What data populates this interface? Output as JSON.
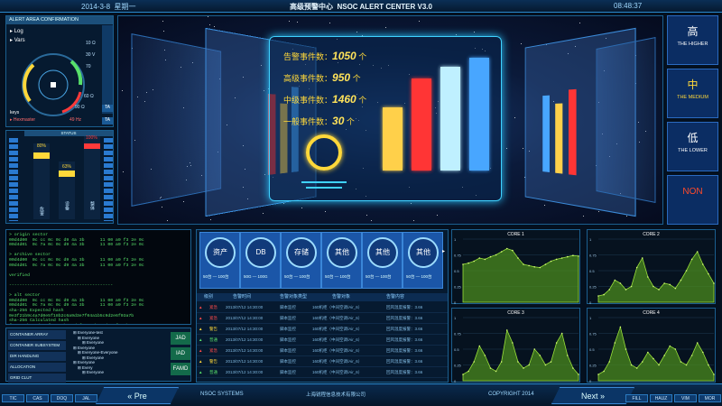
{
  "header": {
    "date": "2014-3-8",
    "weekday": "星期一",
    "title": "高级预警中心",
    "title_en": "NSOC ALERT CENTER V3.0",
    "time": "08:48:37"
  },
  "alert_panel": {
    "heading": "ALERT AREA CONFIRMATION",
    "log": "Log",
    "vars": "Vars",
    "keys": "keys",
    "param": "Hexmaster",
    "values": [
      "10 Ω",
      "30 V",
      "70",
      "60 Ω",
      "90 Ω",
      "49 Hz"
    ],
    "side_buttons": [
      "TA",
      "TA"
    ]
  },
  "status_panel": {
    "heading": "STATUS",
    "pct": [
      "80%",
      "63%",
      "100%"
    ],
    "labels": [
      "危害",
      "设备",
      "整体"
    ]
  },
  "center": {
    "stats": [
      {
        "label": "告警事件数：",
        "value": "1050",
        "unit": "个"
      },
      {
        "label": "高级事件数：",
        "value": "950",
        "unit": "个"
      },
      {
        "label": "中级事件数：",
        "value": "1460",
        "unit": "个"
      },
      {
        "label": "一般事件数：",
        "value": "30",
        "unit": "个"
      }
    ],
    "bars": [
      {
        "value": 0.55,
        "color": "#ffd04a"
      },
      {
        "value": 0.8,
        "color": "#ff3535"
      },
      {
        "value": 0.9,
        "color": "#bff0ff"
      },
      {
        "value": 0.98,
        "color": "#48a6ff"
      }
    ]
  },
  "levels": [
    {
      "cn": "高",
      "en": "THE HIGHER",
      "color": "#ffffff"
    },
    {
      "cn": "中",
      "en": "THE MEDIUM",
      "color": "#ffd83a"
    },
    {
      "cn": "低",
      "en": "THE LOWER",
      "color": "#ffffff"
    },
    {
      "cn": "NON",
      "en": "",
      "color": "#ff4a2a"
    }
  ],
  "console": {
    "text": "> origin sector\n00d4d00  0c cc 0c 0c d9 4a 3b      11 00 a9 f3 2e 0c\n00d4d01  0c 7a 0c 0c d9 4a 3b      11 00 a9 f3 2e 0c\n\n> archive sector\n00d4d00  0c cc 0c 0c d9 4a 3b      11 00 a9 f3 2e 0c\n00d4d01  0c 7a 0c 0c d9 4a 3b      11 00 a9 f3 2e 0c\n\nverified\n\n----------------------------------------\n\n> alt sector\n00d4d00  0c cc 0c 0c d9 4a 3b      11 00 a9 f3 2e 0c\n00d4d01  0c 7a 0c 0c d9 4a 3b      11 00 a9 f3 2e 0c\nsha-256 Expected hash\n0e3f21b9c4a7d0e5f18b2c6a9d3e7f04a1b5c9d2e6f03a7b\nsha-256 Calculated hash\nf1c52e8b9a0d3c7f6e1a4b8c2d5f9e0a3b7c1d4e8f2a6b9c0"
  },
  "tree": {
    "items": [
      "CONTAINER ARRAY",
      "CONTAINER SUBSYSTEM",
      "DIR HANDLING",
      "ALLOCATION",
      "GRID CLUT"
    ],
    "nodes": [
      "Everyone-test",
      "Everyone",
      "Everyone",
      "Everyone",
      "Everyone-Everyone",
      "Everyone",
      "Everyone",
      "Every",
      "Everyone"
    ],
    "buttons": [
      "JAD",
      "IAD",
      "FAMD"
    ]
  },
  "resources": [
    {
      "name": "资产",
      "sub": "50台",
      "max": "100台"
    },
    {
      "name": "DB",
      "sub": "50G",
      "max": "100G"
    },
    {
      "name": "存储",
      "sub": "50台",
      "max": "100台"
    },
    {
      "name": "其他",
      "sub": "50台",
      "max": "100台"
    },
    {
      "name": "其他",
      "sub": "50台",
      "max": "100台"
    },
    {
      "name": "其他",
      "sub": "50台",
      "max": "100台"
    }
  ],
  "alarm_table": {
    "headers": [
      "级别",
      "告警时间",
      "告警对象类型",
      "告警对象",
      "告警内容"
    ],
    "rows": [
      {
        "level": "紧急",
        "time": "2013/07/12 14:30:00",
        "type": "脚本监控",
        "obj": "160机柜（中间空调/Air_6）",
        "content": "回风温度报警：3.66",
        "color": "#ff4a4a"
      },
      {
        "level": "紧急",
        "time": "2013/07/12 14:30:00",
        "type": "脚本监控",
        "obj": "160机柜（中间空调/Air_6）",
        "content": "回风温度报警：3.66",
        "color": "#ff4a4a"
      },
      {
        "level": "警告",
        "time": "2013/07/12 14:30:00",
        "type": "脚本监控",
        "obj": "160机柜（中间空调/Air_6）",
        "content": "回风温度报警：3.66",
        "color": "#ffd83a"
      },
      {
        "level": "普通",
        "time": "2013/07/12 14:30:00",
        "type": "脚本监控",
        "obj": "160机柜（中间空调/Air_6）",
        "content": "回风温度报警：3.66",
        "color": "#58e06a"
      },
      {
        "level": "紧急",
        "time": "2013/07/12 14:30:00",
        "type": "脚本监控",
        "obj": "160机柜（中间空调/Air_6）",
        "content": "回风温度报警：3.66",
        "color": "#ff4a4a"
      },
      {
        "level": "警告",
        "time": "2013/07/12 14:30:00",
        "type": "脚本监控",
        "obj": "160机柜（中间空调/Air_6）",
        "content": "回风温度报警：3.66",
        "color": "#ffd83a"
      },
      {
        "level": "普通",
        "time": "2013/07/12 14:30:00",
        "type": "脚本监控",
        "obj": "160机柜（中间空调/Air_6）",
        "content": "回风温度报警：3.66",
        "color": "#58e06a"
      }
    ]
  },
  "chart_data": [
    {
      "type": "area",
      "title": "CORE 1",
      "ylim": [
        0,
        1
      ],
      "yticks": [
        "1",
        "0.75",
        "0.5",
        "0.25",
        "0"
      ],
      "values": [
        0.6,
        0.62,
        0.65,
        0.7,
        0.68,
        0.72,
        0.75,
        0.8,
        0.85,
        0.82,
        0.7,
        0.6,
        0.58,
        0.56,
        0.55,
        0.6,
        0.65,
        0.68,
        0.7,
        0.72,
        0.74,
        0.73
      ]
    },
    {
      "type": "area",
      "title": "CORE 2",
      "ylim": [
        0,
        1
      ],
      "yticks": [
        "1",
        "0.75",
        "0.5",
        "0.25",
        "0"
      ],
      "values": [
        0.1,
        0.12,
        0.2,
        0.35,
        0.3,
        0.2,
        0.25,
        0.55,
        0.7,
        0.4,
        0.25,
        0.2,
        0.3,
        0.28,
        0.22,
        0.35,
        0.5,
        0.68,
        0.8,
        0.6,
        0.45,
        0.3
      ]
    },
    {
      "type": "area",
      "title": "CORE 3",
      "ylim": [
        0,
        1
      ],
      "yticks": [
        "1",
        "0.75",
        "0.5",
        "0.25",
        "0"
      ],
      "values": [
        0.1,
        0.15,
        0.3,
        0.55,
        0.4,
        0.2,
        0.15,
        0.3,
        0.8,
        0.6,
        0.3,
        0.2,
        0.25,
        0.5,
        0.4,
        0.25,
        0.3,
        0.6,
        0.75,
        0.4,
        0.2,
        0.1
      ]
    },
    {
      "type": "area",
      "title": "CORE 4",
      "ylim": [
        0,
        1
      ],
      "yticks": [
        "1",
        "0.75",
        "0.5",
        "0.25",
        "0"
      ],
      "values": [
        0.1,
        0.15,
        0.3,
        0.6,
        0.85,
        0.5,
        0.25,
        0.2,
        0.3,
        0.45,
        0.35,
        0.25,
        0.4,
        0.55,
        0.5,
        0.3,
        0.25,
        0.4,
        0.6,
        0.45,
        0.25,
        0.1
      ]
    }
  ],
  "footer": {
    "left_keys": [
      "TIC",
      "CAS",
      "DOQ",
      "JAL"
    ],
    "prev": "Pre",
    "next": "Next",
    "brand": "NSOC SYSTEMS",
    "company": "上海锐程信息技术有限公司",
    "copyright": "COPYRIGHT 2014",
    "right_keys": [
      "FILL",
      "HAUZ",
      "VIM",
      "MOR"
    ]
  }
}
